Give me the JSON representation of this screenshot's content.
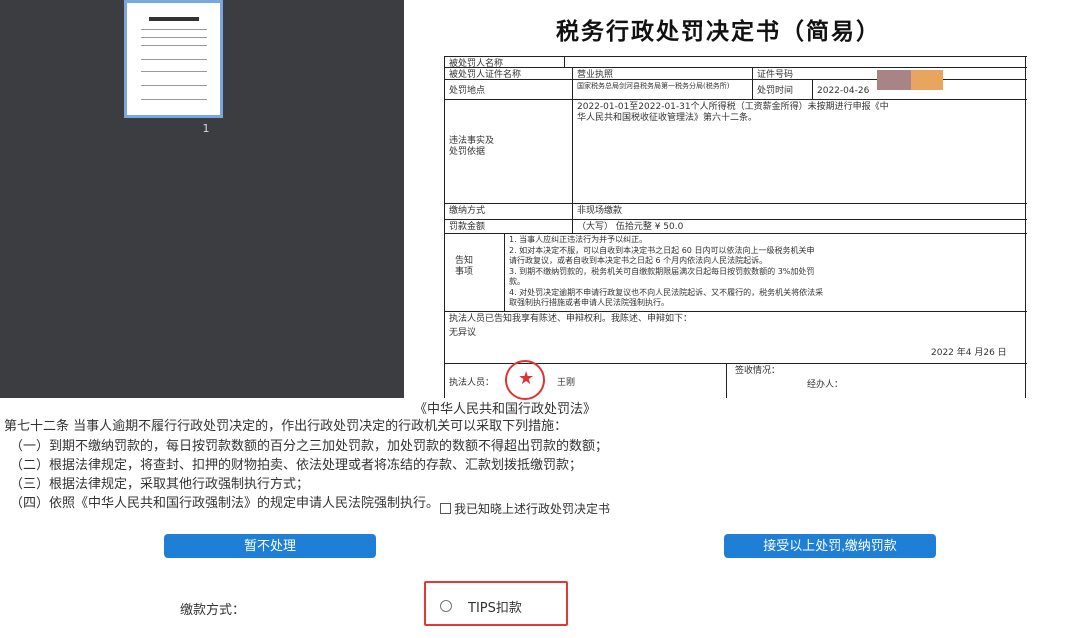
{
  "viewer": {
    "page_number": "1",
    "document_title": "税务行政处罚决定书（简易）",
    "form": {
      "party_name_label": "被处罚人名称",
      "party_id_label": "被处罚人证件名称",
      "party_id_value": "营业执照",
      "id_number_label": "证件号码",
      "location_label": "处罚地点",
      "location_value": "国家税务总局剑河县税务局第一税务分局(税务所)",
      "time_label": "处罚时间",
      "time_value": "2022-04-26",
      "violation_label_1": "违法事实及",
      "violation_label_2": "处罚依据",
      "violation_text_1": "2022-01-01至2022-01-31个人所得税（工资薪金所得）未按期进行申报《中",
      "violation_text_2": "华人民共和国税收征收管理法》第六十二条。",
      "pay_method_label": "缴纳方式",
      "pay_method_value": "非现场缴款",
      "fine_label": "罚款金额",
      "fine_value": "（大写）  伍拾元整 ¥ 50.0",
      "notice_label_1": "告知",
      "notice_label_2": "事项",
      "notice_lines": [
        "1. 当事人应纠正违法行为并予以纠正。",
        "2. 如对本决定不服，可以自收到本决定书之日起 60 日内可以依法向上一级税务机关申",
        "请行政复议，或者自收到本决定书之日起 6 个月内依法向人民法院起诉。",
        "3. 到期不缴纳罚款的，税务机关可自缴款期限届满次日起每日按罚款数额的 3%加处罚",
        "款。",
        "4. 对处罚决定逾期不申请行政复议也不向人民法院起诉、又不履行的，税务机关将依法采",
        "取强制执行措施或者申请人民法院强制执行。"
      ],
      "statement_text": "执法人员已告知我享有陈述、申辩权利。我陈述、申辩如下：",
      "statement_value": "无异议",
      "date_text": "2022 年4 月26 日",
      "officer_label": "执法人员：",
      "officer_name": "王刚",
      "receipt_label": "签收情况：",
      "handler_label": "经办人："
    }
  },
  "law": {
    "title": "《中华人民共和国行政处罚法》",
    "lines": [
      "第七十二条  当事人逾期不履行行政处罚决定的，作出行政处罚决定的行政机关可以采取下列措施：",
      "（一）到期不缴纳罚款的，每日按罚款数额的百分之三加处罚款，加处罚款的数额不得超出罚款的数额；",
      "（二）根据法律规定，将查封、扣押的财物拍卖、依法处理或者将冻结的存款、汇款划拨抵缴罚款；",
      "（三）根据法律规定，采取其他行政强制执行方式；",
      "（四）依照《中华人民共和国行政强制法》的规定申请人民法院强制执行。"
    ],
    "ack_label": "我已知晓上述行政处罚决定书"
  },
  "actions": {
    "defer_label": "暂不处理",
    "accept_label": "接受以上处罚,缴纳罚款"
  },
  "payment": {
    "label": "缴款方式：",
    "option_label": "TIPS扣款"
  },
  "colors": {
    "button_blue": "#1f7fd6",
    "highlight_red": "#e53935",
    "panel_dark": "#3b3d40"
  }
}
